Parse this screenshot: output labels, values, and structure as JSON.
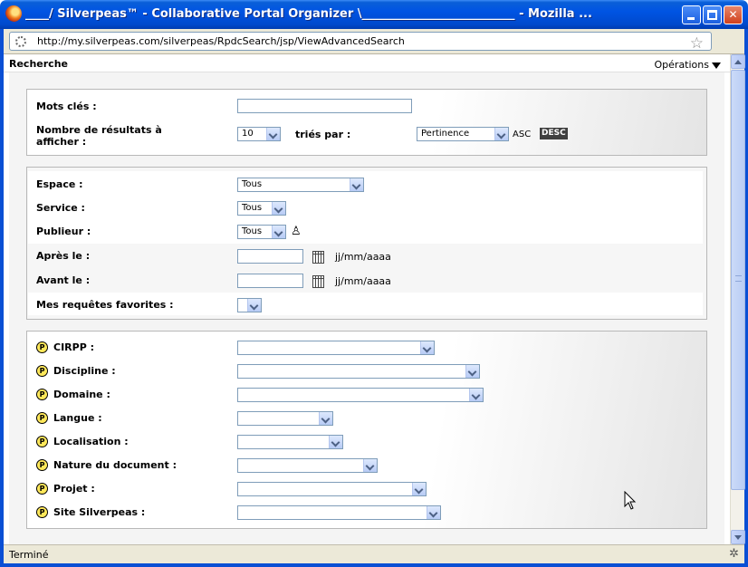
{
  "window": {
    "title": "____/ Silverpeas™ - Collaborative Portal Organizer \\__________________________ - Mozilla ...",
    "url": "http://my.silverpeas.com/silverpeas/RpdcSearch/jsp/ViewAdvancedSearch",
    "status": "Terminé"
  },
  "header": {
    "title": "Recherche",
    "operations_label": "Opérations"
  },
  "search": {
    "keywords_label": "Mots clés :",
    "keywords_value": "",
    "results_label_line1": "Nombre de résultats à",
    "results_label_line2": "afficher :",
    "results_count": "10",
    "sort_label": "triés par :",
    "sort_value": "Pertinence",
    "asc_label": "ASC",
    "desc_label": "DESC"
  },
  "filters": {
    "space_label": "Espace :",
    "space_value": "Tous",
    "service_label": "Service :",
    "service_value": "Tous",
    "publisher_label": "Publieur :",
    "publisher_value": "Tous",
    "after_label": "Après le :",
    "after_value": "",
    "after_format": "jj/mm/aaaa",
    "before_label": "Avant le :",
    "before_value": "",
    "before_format": "jj/mm/aaaa",
    "favorites_label": "Mes requêtes favorites :",
    "favorites_value": ""
  },
  "pdc": {
    "axes": [
      {
        "label": "CIRPP :",
        "value": ""
      },
      {
        "label": "Discipline :",
        "value": ""
      },
      {
        "label": "Domaine :",
        "value": ""
      },
      {
        "label": "Langue :",
        "value": ""
      },
      {
        "label": "Localisation :",
        "value": ""
      },
      {
        "label": "Nature du document :",
        "value": ""
      },
      {
        "label": "Projet :",
        "value": ""
      },
      {
        "label": "Site Silverpeas :",
        "value": ""
      }
    ]
  },
  "icons": {
    "window": "firefox-icon",
    "minimize": "minimize-icon",
    "maximize": "maximize-icon",
    "close": "close-icon",
    "bookmark": "star-icon",
    "calendar": "calendar-icon",
    "publisher": "user-picker-icon",
    "pdc_axis": "pdc-axis-icon",
    "status": "bug-icon"
  },
  "colors": {
    "titlebar": "#0054e3",
    "desc_badge": "#404040",
    "pdc_icon": "#ffe85a"
  }
}
